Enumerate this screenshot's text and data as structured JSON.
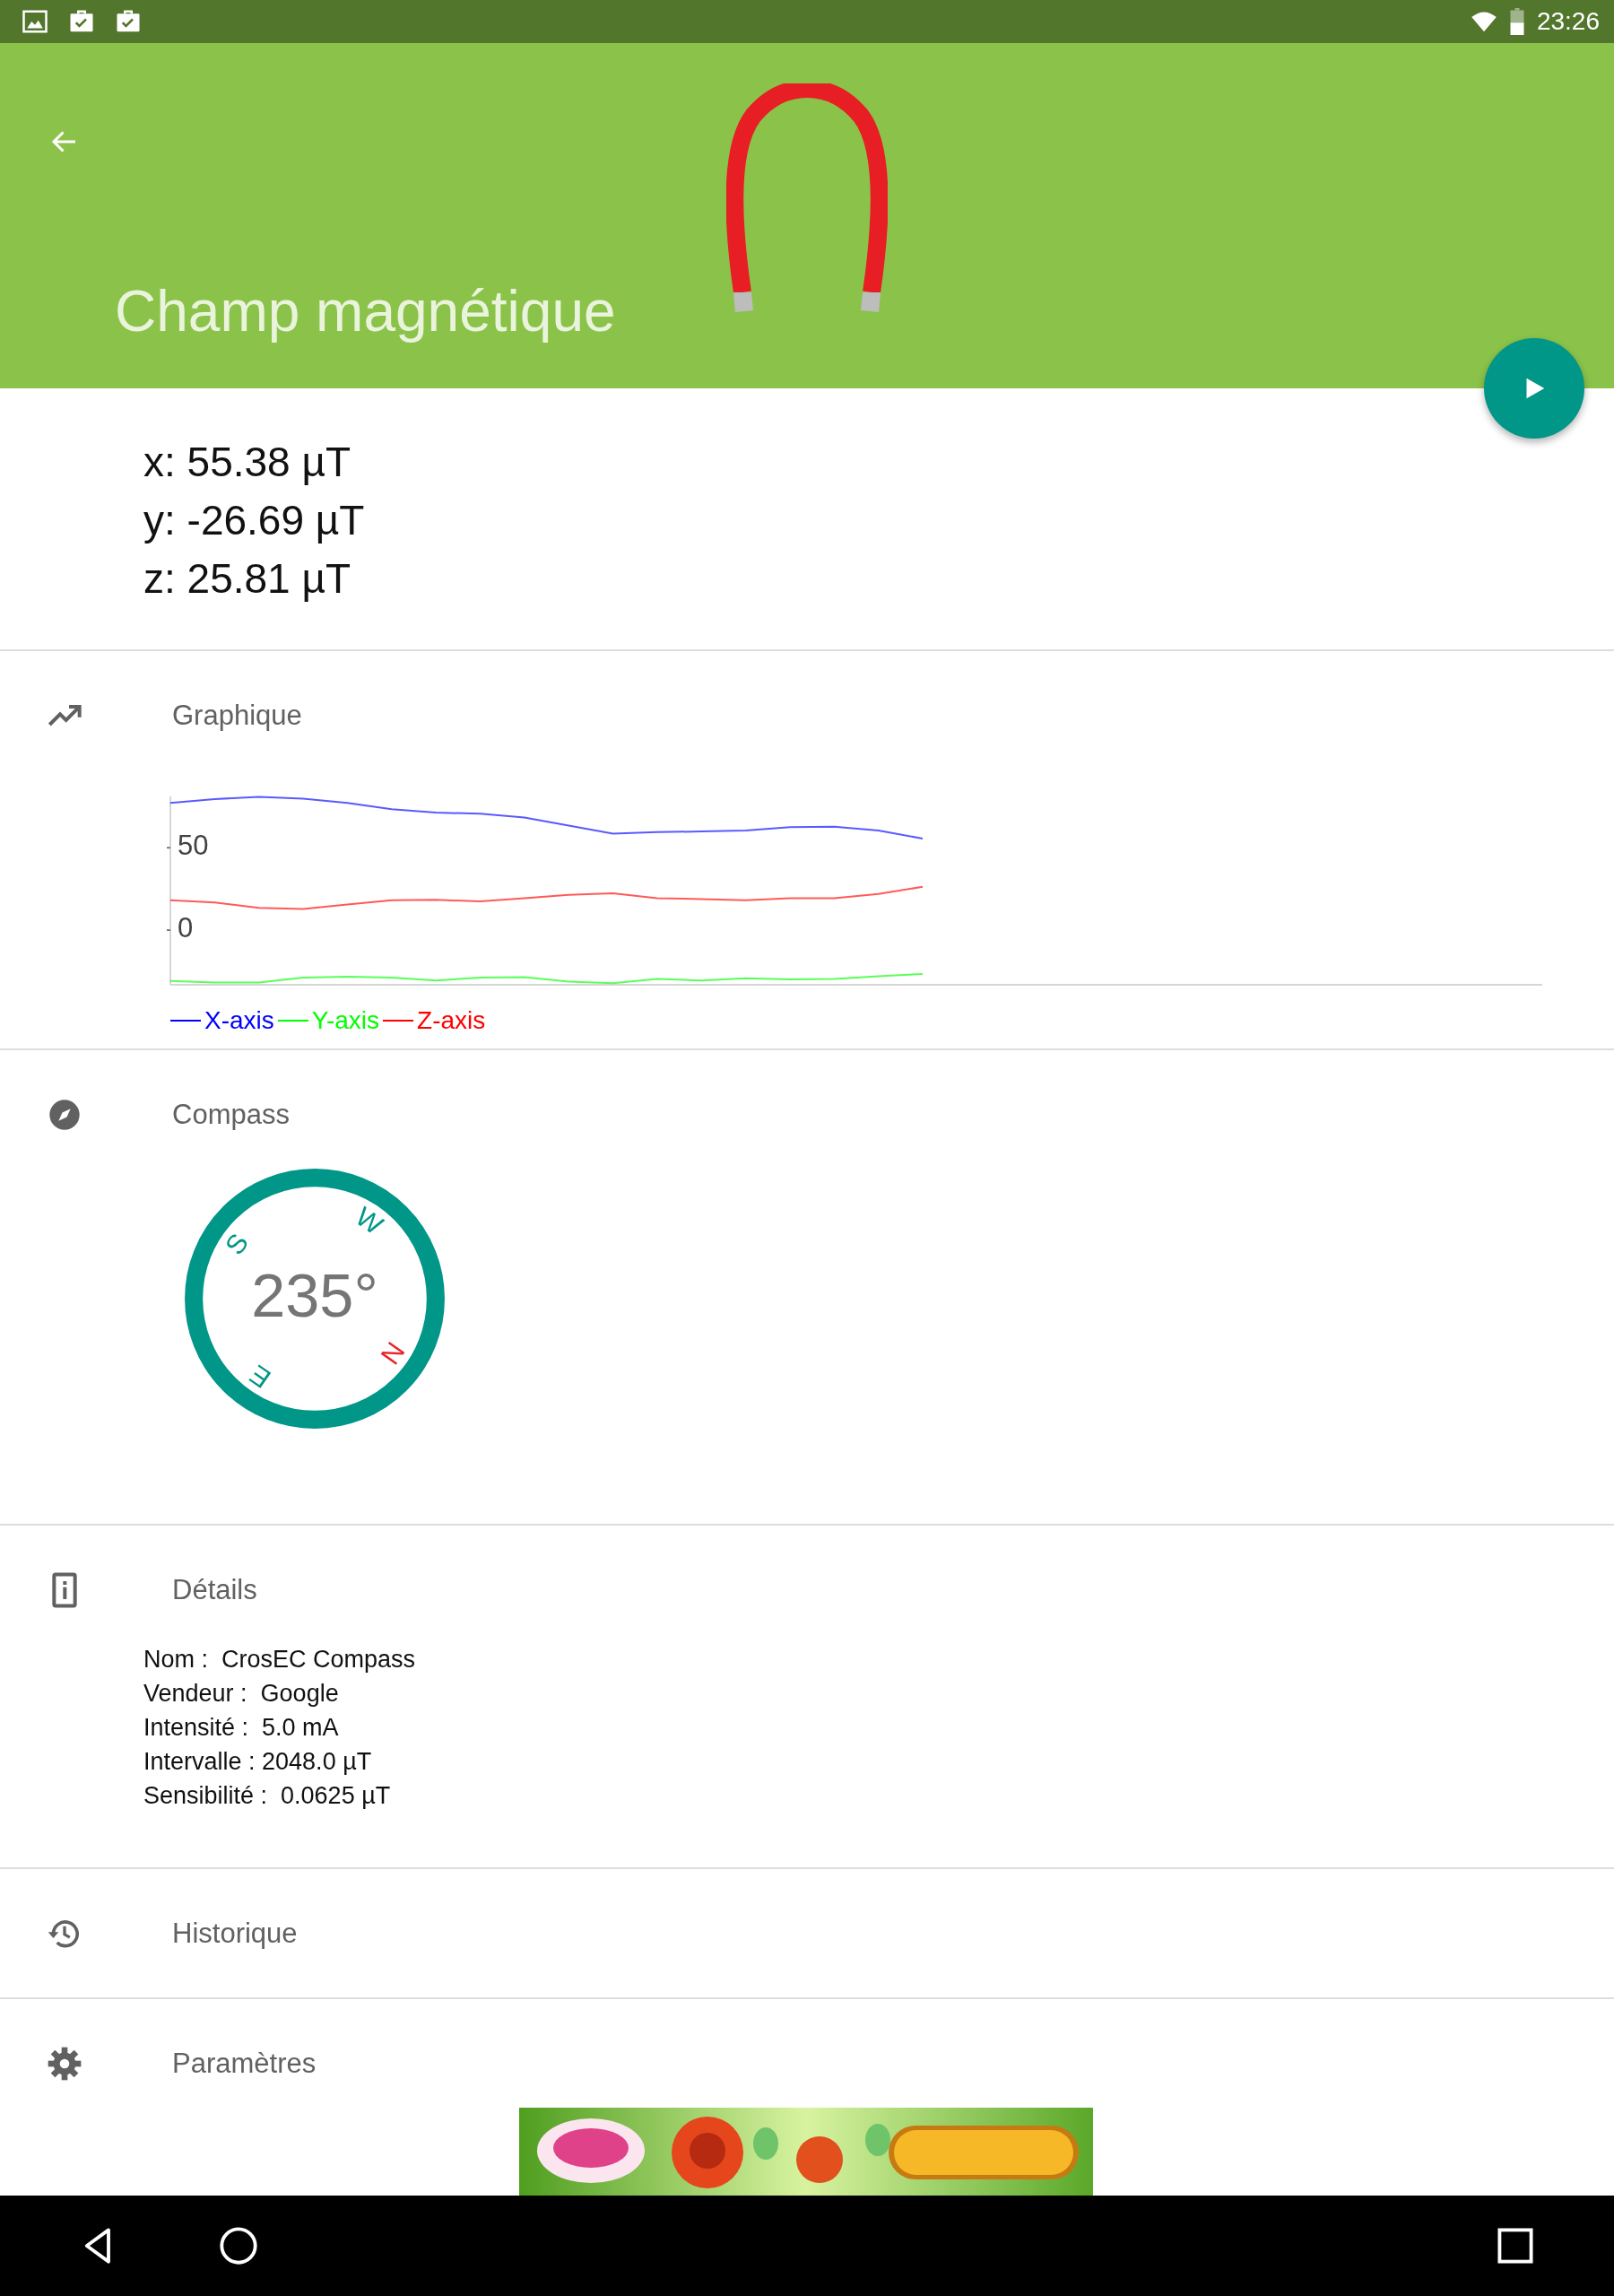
{
  "status_bar": {
    "time": "23:26"
  },
  "header": {
    "title": "Champ magnétique"
  },
  "readings": [
    "x: 55.38 µT",
    "y: -26.69 µT",
    "z: 25.81 µT"
  ],
  "sections": [
    {
      "kind": "chart",
      "title": "Graphique",
      "chart_data": {
        "type": "line",
        "legend": "bottom",
        "categories": [
          null,
          null,
          null,
          null,
          null,
          null,
          null,
          null,
          null,
          null,
          null,
          null,
          null,
          null,
          null,
          null,
          null,
          null
        ],
        "ylim": [
          -33.2,
          81.2
        ],
        "yticks": [
          0,
          50
        ],
        "series": [
          {
            "name": "X-axis",
            "color": "#0000ff",
            "values": [
              77.3,
              79.6,
              80.9,
              79.9,
              77.3,
              73.4,
              71.4,
              70.7,
              68.4,
              63.5,
              58.6,
              59.5,
              59.9,
              60.5,
              62.5,
              62.8,
              60.5,
              55.6
            ]
          },
          {
            "name": "Y-axis",
            "color": "#00ff00",
            "values": [
              -30.9,
              -31.9,
              -31.9,
              -28.9,
              -28.3,
              -28.9,
              -30.6,
              -28.9,
              -28.6,
              -31.3,
              -32.2,
              -29.6,
              -30.6,
              -29.3,
              -29.9,
              -29.6,
              -28.0,
              -26.6
            ]
          },
          {
            "name": "Z-axis",
            "color": "#ff0000",
            "values": [
              18.1,
              16.8,
              13.5,
              12.8,
              15.5,
              18.1,
              18.4,
              17.4,
              19.4,
              21.4,
              22.4,
              19.4,
              18.8,
              18.1,
              19.4,
              19.4,
              22.0,
              26.3
            ]
          }
        ]
      }
    },
    {
      "kind": "compass",
      "title": "Compass",
      "heading": "235°",
      "directions": [
        {
          "label": "N",
          "color": "#e8262b"
        },
        {
          "label": "E",
          "color": "#009688"
        },
        {
          "label": "S",
          "color": "#009688"
        },
        {
          "label": "W",
          "color": "#009688"
        }
      ]
    },
    {
      "kind": "details",
      "title": "Détails",
      "lines": [
        "Nom :  CrosEC Compass",
        "Vendeur :  Google",
        "Intensité :  5.0 mA",
        "Intervalle : 2048.0 µT",
        "Sensibilité :  0.0625 µT"
      ]
    },
    {
      "kind": "history",
      "title": "Historique"
    },
    {
      "kind": "settings",
      "title": "Paramètres"
    }
  ],
  "ad": {
    "kind": "picture"
  }
}
